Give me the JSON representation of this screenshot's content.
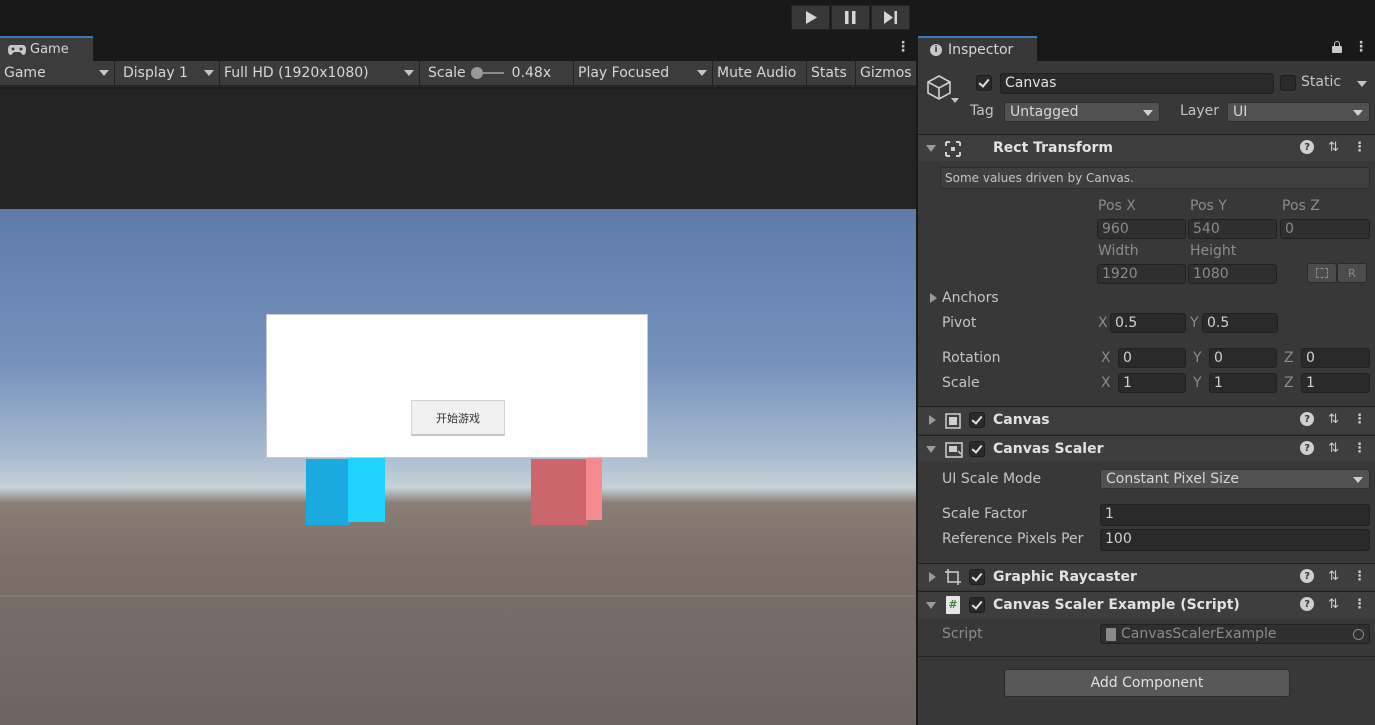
{
  "toolbar": {
    "play": "play-button",
    "pause": "pause-button",
    "step": "step-button"
  },
  "game": {
    "tab_label": "Game",
    "mode": "Game",
    "display": "Display 1",
    "resolution": "Full HD (1920x1080)",
    "scale_label": "Scale",
    "scale_value": "0.48x",
    "scale_slider": 0.1,
    "play_mode": "Play Focused",
    "mute": "Mute Audio",
    "stats": "Stats",
    "gizmos": "Gizmos",
    "ui_button_label": "开始游戏"
  },
  "inspector": {
    "tab_label": "Inspector",
    "object_name": "Canvas",
    "static_label": "Static",
    "tag_label": "Tag",
    "tag_value": "Untagged",
    "layer_label": "Layer",
    "layer_value": "UI",
    "rect_transform": {
      "title": "Rect Transform",
      "info": "Some values driven by Canvas.",
      "pos_x_label": "Pos X",
      "pos_x": "960",
      "pos_y_label": "Pos Y",
      "pos_y": "540",
      "pos_z_label": "Pos Z",
      "pos_z": "0",
      "width_label": "Width",
      "width": "1920",
      "height_label": "Height",
      "height": "1080",
      "anchors_label": "Anchors",
      "pivot_label": "Pivot",
      "pivot_x": "0.5",
      "pivot_y": "0.5",
      "rotation_label": "Rotation",
      "rot_x": "0",
      "rot_y": "0",
      "rot_z": "0",
      "scale_label": "Scale",
      "scale_x": "1",
      "scale_y": "1",
      "scale_z": "1",
      "x": "X",
      "y": "Y",
      "z": "Z",
      "r_btn": "R"
    },
    "canvas": {
      "title": "Canvas"
    },
    "canvas_scaler": {
      "title": "Canvas Scaler",
      "ui_scale_mode_label": "UI Scale Mode",
      "ui_scale_mode": "Constant Pixel Size",
      "scale_factor_label": "Scale Factor",
      "scale_factor": "1",
      "ref_pixels_label": "Reference Pixels Per",
      "ref_pixels": "100"
    },
    "graphic_raycaster": {
      "title": "Graphic Raycaster"
    },
    "script_component": {
      "title": "Canvas Scaler Example (Script)",
      "script_label": "Script",
      "script_value": "CanvasScalerExample"
    },
    "add_component": "Add Component"
  }
}
